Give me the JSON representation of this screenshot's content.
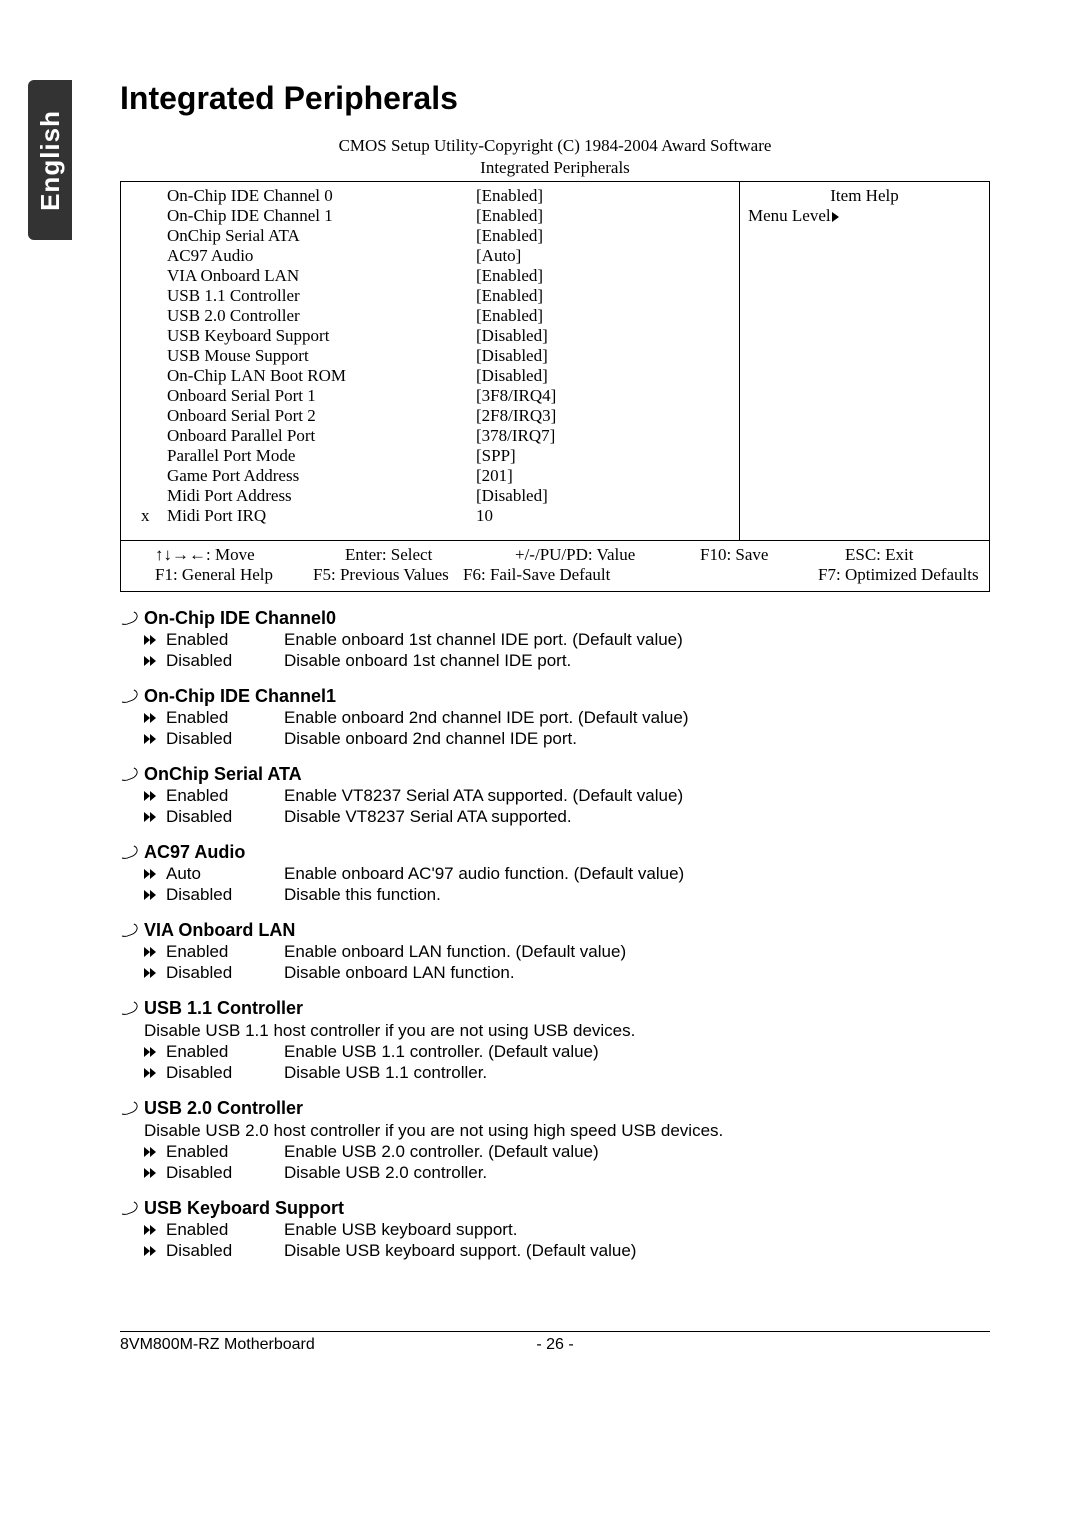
{
  "sideTab": "English",
  "title": "Integrated Peripherals",
  "biosHeader1": "CMOS Setup Utility-Copyright (C) 1984-2004 Award Software",
  "biosHeader2": "Integrated Peripherals",
  "biosHelpTitle": "Item Help",
  "biosMenuLevel": "Menu Level",
  "biosRows": [
    {
      "label": "On-Chip IDE Channel 0",
      "value": "[Enabled]",
      "x": false
    },
    {
      "label": "On-Chip IDE Channel 1",
      "value": "[Enabled]",
      "x": false
    },
    {
      "label": "OnChip Serial ATA",
      "value": "[Enabled]",
      "x": false
    },
    {
      "label": "AC97 Audio",
      "value": "[Auto]",
      "x": false
    },
    {
      "label": "VIA Onboard LAN",
      "value": "[Enabled]",
      "x": false
    },
    {
      "label": "USB 1.1 Controller",
      "value": "[Enabled]",
      "x": false
    },
    {
      "label": "USB 2.0 Controller",
      "value": "[Enabled]",
      "x": false
    },
    {
      "label": "USB Keyboard Support",
      "value": "[Disabled]",
      "x": false
    },
    {
      "label": "USB Mouse Support",
      "value": "[Disabled]",
      "x": false
    },
    {
      "label": "On-Chip LAN Boot ROM",
      "value": "[Disabled]",
      "x": false
    },
    {
      "label": "Onboard Serial Port 1",
      "value": "[3F8/IRQ4]",
      "x": false
    },
    {
      "label": "Onboard Serial Port 2",
      "value": "[2F8/IRQ3]",
      "x": false
    },
    {
      "label": "Onboard Parallel Port",
      "value": "[378/IRQ7]",
      "x": false
    },
    {
      "label": "Parallel Port Mode",
      "value": "[SPP]",
      "x": false
    },
    {
      "label": "Game Port Address",
      "value": "[201]",
      "x": false
    },
    {
      "label": "Midi Port Address",
      "value": "[Disabled]",
      "x": false
    },
    {
      "label": "Midi Port IRQ",
      "value": "10",
      "x": true
    }
  ],
  "biosFooter": {
    "move": "↑↓→←: Move",
    "enter": "Enter: Select",
    "pupd": "+/-/PU/PD: Value",
    "f10": "F10: Save",
    "esc": "ESC: Exit",
    "f1": "F1: General Help",
    "f5": "F5: Previous Values",
    "f6": "F6: Fail-Save Default",
    "f7": "F7: Optimized Defaults"
  },
  "sections": [
    {
      "title": "On-Chip IDE Channel0",
      "note": "",
      "opts": [
        {
          "name": "Enabled",
          "desc": "Enable onboard 1st channel IDE port. (Default value)"
        },
        {
          "name": "Disabled",
          "desc": "Disable onboard 1st channel IDE port."
        }
      ]
    },
    {
      "title": "On-Chip IDE Channel1",
      "note": "",
      "opts": [
        {
          "name": "Enabled",
          "desc": "Enable onboard 2nd channel IDE port. (Default value)"
        },
        {
          "name": "Disabled",
          "desc": "Disable onboard 2nd channel IDE port."
        }
      ]
    },
    {
      "title": "OnChip Serial ATA",
      "note": "",
      "opts": [
        {
          "name": "Enabled",
          "desc": "Enable VT8237 Serial ATA supported. (Default value)"
        },
        {
          "name": "Disabled",
          "desc": "Disable VT8237 Serial ATA supported."
        }
      ]
    },
    {
      "title": "AC97 Audio",
      "note": "",
      "opts": [
        {
          "name": "Auto",
          "desc": "Enable onboard AC'97 audio function. (Default value)"
        },
        {
          "name": "Disabled",
          "desc": "Disable this function."
        }
      ]
    },
    {
      "title": "VIA Onboard LAN",
      "note": "",
      "opts": [
        {
          "name": "Enabled",
          "desc": "Enable onboard LAN function. (Default value)"
        },
        {
          "name": "Disabled",
          "desc": "Disable onboard LAN function."
        }
      ]
    },
    {
      "title": "USB 1.1 Controller",
      "note": "Disable USB 1.1 host controller if you are not using USB devices.",
      "opts": [
        {
          "name": "Enabled",
          "desc": "Enable USB 1.1 controller. (Default value)"
        },
        {
          "name": "Disabled",
          "desc": "Disable USB 1.1 controller."
        }
      ]
    },
    {
      "title": "USB 2.0 Controller",
      "note": "Disable USB 2.0 host controller if you are not using high speed USB devices.",
      "opts": [
        {
          "name": "Enabled",
          "desc": "Enable USB 2.0 controller. (Default value)"
        },
        {
          "name": "Disabled",
          "desc": "Disable USB 2.0 controller."
        }
      ]
    },
    {
      "title": "USB Keyboard Support",
      "note": "",
      "opts": [
        {
          "name": "Enabled",
          "desc": "Enable USB keyboard support."
        },
        {
          "name": "Disabled",
          "desc": "Disable USB keyboard support. (Default value)"
        }
      ]
    }
  ],
  "footer": {
    "left": "8VM800M-RZ Motherboard",
    "center": "- 26 -"
  }
}
